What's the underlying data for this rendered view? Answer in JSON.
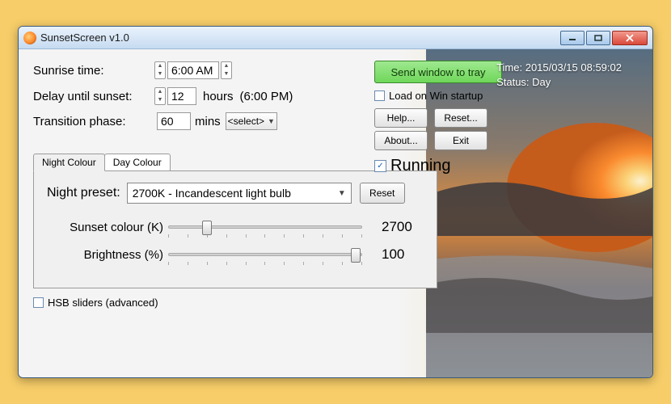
{
  "window": {
    "title": "SunsetScreen v1.0"
  },
  "settings": {
    "sunrise_label": "Sunrise time:",
    "sunrise_value": "6:00 AM",
    "delay_label": "Delay until sunset:",
    "delay_value": "12",
    "delay_unit": "hours",
    "delay_computed": "(6:00 PM)",
    "transition_label": "Transition phase:",
    "transition_value": "60",
    "transition_unit": "mins",
    "select_placeholder": "<select>"
  },
  "actions": {
    "tray": "Send window to tray",
    "load_startup": "Load on Win startup",
    "help": "Help...",
    "reset": "Reset...",
    "about": "About...",
    "exit": "Exit",
    "running": "Running"
  },
  "overlay": {
    "time": "Time: 2015/03/15 08:59:02",
    "status": "Status: Day"
  },
  "tabs": {
    "night": "Night Colour",
    "day": "Day Colour"
  },
  "panel": {
    "preset_label": "Night preset:",
    "preset_value": "2700K - Incandescent light bulb",
    "preset_reset": "Reset",
    "colour_label": "Sunset colour (K)",
    "colour_value": "2700",
    "brightness_label": "Brightness (%)",
    "brightness_value": "100"
  },
  "hsb": {
    "label": "HSB sliders (advanced)"
  }
}
